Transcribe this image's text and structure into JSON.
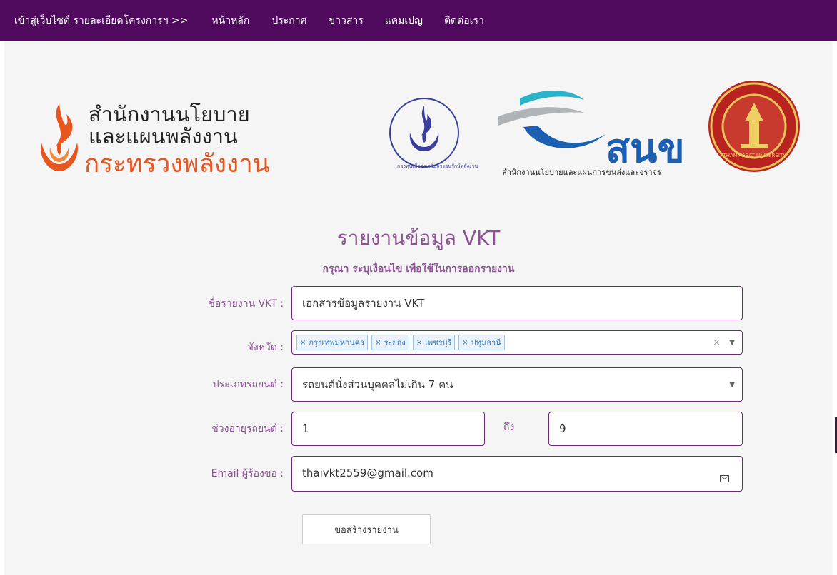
{
  "nav": {
    "items": [
      "เข้าสู่เว็บไซต์ รายละเอียดโครงการฯ >>",
      "หน้าหลัก",
      "ประกาศ",
      "ข่าวสาร",
      "แคมเปญ",
      "ติดต่อเรา"
    ]
  },
  "logos": {
    "energy_line1": "สำนักงานนโยบาย",
    "energy_line2": "และแผนพลังงาน",
    "energy_line3": "กระทรวงพลังงาน",
    "fund_text": "กองทุนเพื่อส่งเสริมการอนุรักษ์พลังงาน",
    "otp_brand": "สนข",
    "otp_sub": "สำนักงานนโยบายและแผนการขนส่งและจราจร",
    "tu_text": "THAMMASAT UNIVERSITY"
  },
  "form": {
    "title": "รายงานข้อมูล VKT",
    "subtitle": "กรุณา ระบุเงื่อนไข เพื่อใช้ในการออกรายงาน",
    "report_name_label": "ชื่อรายงาน VKT :",
    "report_name_value": "เอกสารข้อมูลรายงาน VKT",
    "province_label": "จังหวัด :",
    "provinces": [
      "กรุงเทพมหานคร",
      "ระยอง",
      "เพชรบุรี",
      "ปทุมธานี"
    ],
    "vehicle_type_label": "ประเภทรถยนต์ :",
    "vehicle_type_value": "รถยนต์นั่งส่วนบุคคลไม่เกิน 7 คน",
    "age_label": "ช่วงอายุรถยนต์ :",
    "age_from": "1",
    "age_to_label": "ถึง",
    "age_to": "9",
    "email_label": "Email ผู้ร้องขอ :",
    "email_value": "thaivkt2559@gmail.com",
    "submit_label": "ขอสร้างรายงาน"
  },
  "colors": {
    "navbar": "#4f0a5e",
    "accent_text": "#8c5294",
    "field_border": "#6a2a78",
    "energy_orange": "#e8561f",
    "otp_blue": "#1c5fb0"
  }
}
